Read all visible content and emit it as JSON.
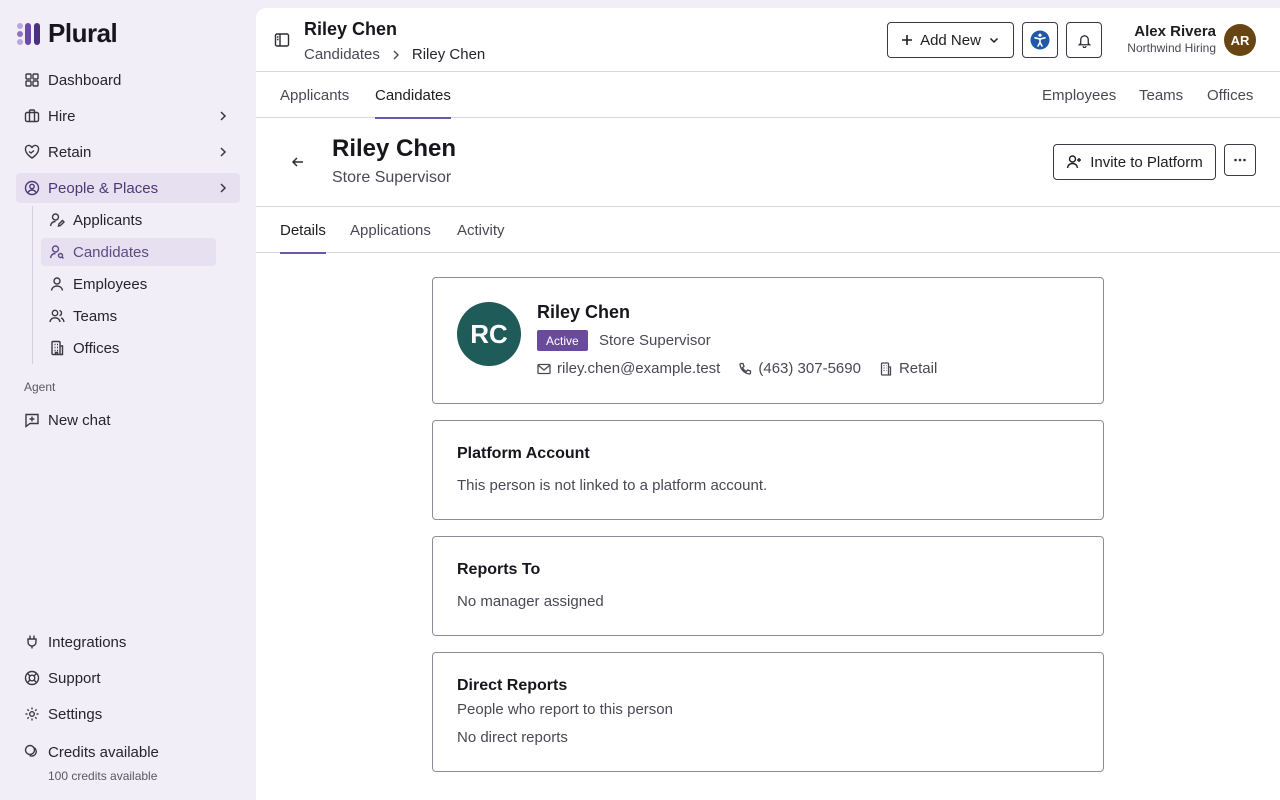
{
  "app": {
    "logo_text": "Plural"
  },
  "sidebar": {
    "items": [
      {
        "label": "Dashboard",
        "icon": "grid-icon"
      },
      {
        "label": "Hire",
        "icon": "briefcase-icon"
      },
      {
        "label": "Retain",
        "icon": "heart-handshake-icon"
      },
      {
        "label": "People & Places",
        "icon": "user-circle-icon"
      }
    ],
    "sub_items": [
      {
        "label": "Applicants",
        "icon": "user-pen-icon"
      },
      {
        "label": "Candidates",
        "icon": "user-search-icon"
      },
      {
        "label": "Employees",
        "icon": "user-icon"
      },
      {
        "label": "Teams",
        "icon": "users-icon"
      },
      {
        "label": "Offices",
        "icon": "building-icon"
      }
    ],
    "agent_section_label": "Agent",
    "new_chat_label": "New chat",
    "bottom_items": [
      {
        "label": "Integrations",
        "icon": "plug-icon"
      },
      {
        "label": "Support",
        "icon": "lifebuoy-icon"
      },
      {
        "label": "Settings",
        "icon": "gear-icon"
      },
      {
        "label": "Credits available",
        "icon": "coins-icon"
      }
    ],
    "credits_sub": "100 credits available"
  },
  "header": {
    "title": "Riley Chen",
    "breadcrumb": [
      "Candidates",
      "Riley Chen"
    ],
    "add_new_label": "Add New",
    "user_name": "Alex Rivera",
    "user_org": "Northwind Hiring",
    "user_initials": "AR"
  },
  "subnav": {
    "left_tabs": [
      "Applicants",
      "Candidates"
    ],
    "right_tabs": [
      "Employees",
      "Teams",
      "Offices"
    ]
  },
  "person": {
    "name": "Riley Chen",
    "role": "Store Supervisor",
    "initials": "RC",
    "status": "Active",
    "email": "riley.chen@example.test",
    "phone": "(463) 307-5690",
    "department": "Retail"
  },
  "actions": {
    "invite_label": "Invite to Platform"
  },
  "detail_tabs": [
    "Details",
    "Applications",
    "Activity"
  ],
  "cards": {
    "platform": {
      "title": "Platform Account",
      "text": "This person is not linked to a platform account."
    },
    "reports_to": {
      "title": "Reports To",
      "text": "No manager assigned"
    },
    "direct_reports": {
      "title": "Direct Reports",
      "subtitle": "People who report to this person",
      "text": "No direct reports"
    }
  },
  "colors": {
    "accent": "#6d55a8",
    "badge": "#6a4a9c",
    "avatar_candidate": "#1f5b58",
    "avatar_user": "#6a4514",
    "sidebar_bg": "#f1eef7"
  }
}
